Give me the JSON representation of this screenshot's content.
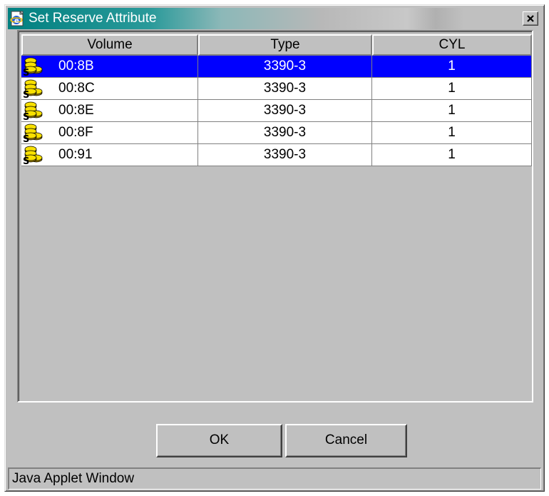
{
  "window": {
    "title": "Set Reserve Attribute",
    "close_label": "×"
  },
  "table": {
    "columns": [
      "Volume",
      "Type",
      "CYL"
    ],
    "rows": [
      {
        "volume": "00:8B",
        "type": "3390-3",
        "cyl": "1",
        "selected": true
      },
      {
        "volume": "00:8C",
        "type": "3390-3",
        "cyl": "1",
        "selected": false
      },
      {
        "volume": "00:8E",
        "type": "3390-3",
        "cyl": "1",
        "selected": false
      },
      {
        "volume": "00:8F",
        "type": "3390-3",
        "cyl": "1",
        "selected": false
      },
      {
        "volume": "00:91",
        "type": "3390-3",
        "cyl": "1",
        "selected": false
      }
    ],
    "volume_icon": "stacked-disks-icon"
  },
  "buttons": {
    "ok_label": "OK",
    "cancel_label": "Cancel"
  },
  "status": {
    "text": "Java Applet Window"
  },
  "colors": {
    "selection": "#0000ff",
    "title_start": "#008080",
    "face": "#c0c0c0"
  }
}
